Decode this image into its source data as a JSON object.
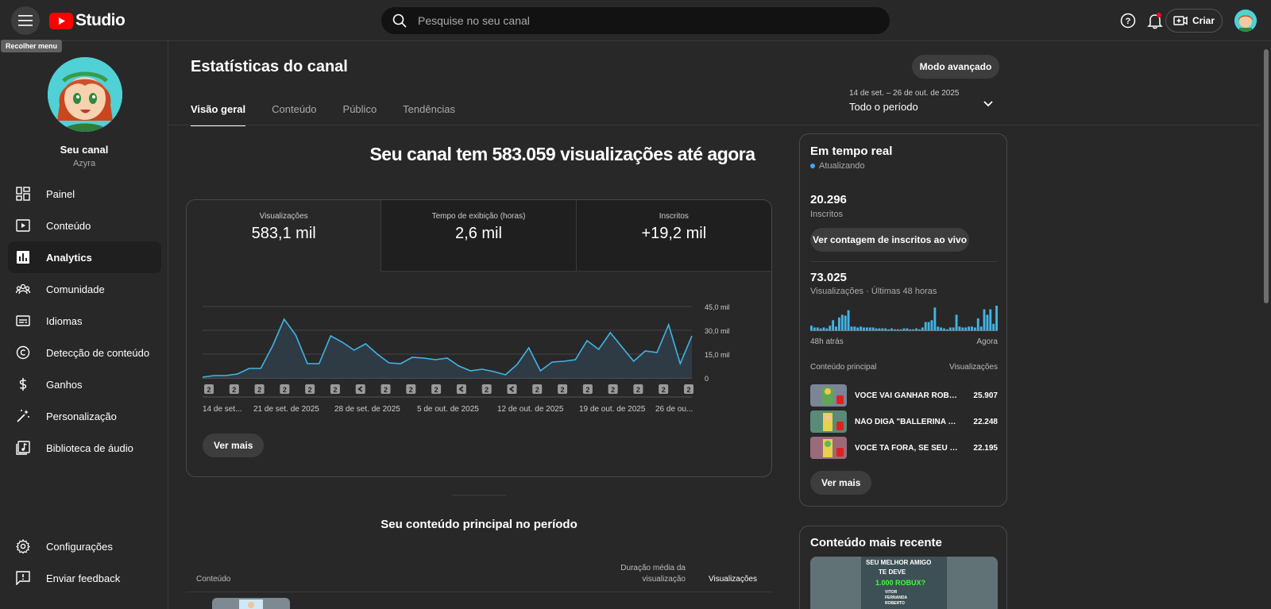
{
  "header": {
    "logo_text": "Studio",
    "collapse_tooltip": "Recolher menu",
    "search_placeholder": "Pesquise no seu canal",
    "create_label": "Criar"
  },
  "sidebar": {
    "channel_name": "Seu canal",
    "channel_handle": "Azyra",
    "items": [
      {
        "label": "Painel",
        "icon": "dashboard-icon"
      },
      {
        "label": "Conteúdo",
        "icon": "content-icon"
      },
      {
        "label": "Analytics",
        "icon": "analytics-icon",
        "active": true
      },
      {
        "label": "Comunidade",
        "icon": "community-icon"
      },
      {
        "label": "Idiomas",
        "icon": "subtitles-icon"
      },
      {
        "label": "Detecção de conteúdo",
        "icon": "copyright-icon"
      },
      {
        "label": "Ganhos",
        "icon": "dollar-icon"
      },
      {
        "label": "Personalização",
        "icon": "magic-wand-icon"
      },
      {
        "label": "Biblioteca de áudio",
        "icon": "audio-library-icon"
      }
    ],
    "bottom_items": [
      {
        "label": "Configurações",
        "icon": "gear-icon"
      },
      {
        "label": "Enviar feedback",
        "icon": "feedback-icon"
      }
    ]
  },
  "main": {
    "title": "Estatísticas do canal",
    "advanced_label": "Modo avançado",
    "tabs": [
      {
        "label": "Visão geral",
        "active": true
      },
      {
        "label": "Conteúdo"
      },
      {
        "label": "Público"
      },
      {
        "label": "Tendências"
      }
    ],
    "period_range": "14 de set. – 26 de out. de 2025",
    "period_label": "Todo o período",
    "headline": "Seu canal tem 583.059 visualizações até agora",
    "metrics": [
      {
        "label": "Visualizações",
        "value": "583,1 mil"
      },
      {
        "label": "Tempo de exibição (horas)",
        "value": "2,6 mil"
      },
      {
        "label": "Inscritos",
        "value": "+19,2 mil"
      }
    ],
    "chart_more_label": "Ver mais",
    "top_content_title": "Seu conteúdo principal no período",
    "top_content_headers": {
      "content": "Conteúdo",
      "avg_duration": "Duração média da visualização",
      "views": "Visualizações"
    }
  },
  "chart_data": {
    "type": "area",
    "x_labels": [
      "14 de set...",
      "21 de set. de 2025",
      "28 de set. de 2025",
      "5 de out. de 2025",
      "12 de out. de 2025",
      "19 de out. de 2025",
      "26 de ou..."
    ],
    "y_ticks": [
      "45,0 mil",
      "30,0 mil",
      "15,0 mil",
      "0"
    ],
    "ylim": [
      0,
      45000
    ],
    "values": [
      500,
      1500,
      1500,
      2500,
      6000,
      6000,
      20000,
      37000,
      27000,
      9000,
      9000,
      26500,
      22500,
      17500,
      21500,
      15000,
      9500,
      9000,
      13000,
      12500,
      11500,
      12500,
      7500,
      4500,
      5500,
      4000,
      2000,
      8500,
      19000,
      4500,
      10000,
      10500,
      11500,
      23500,
      18000,
      28500,
      19500,
      10500,
      17000,
      16000,
      33500,
      9000,
      26500
    ],
    "upload_markers": [
      "2",
      "2",
      "2",
      "2",
      "2",
      "2",
      "short",
      "2",
      "2",
      "2",
      "short",
      "2",
      "short",
      "2",
      "2",
      "2",
      "2",
      "2",
      "2",
      "2"
    ],
    "color": "#41b4e6"
  },
  "realtime": {
    "title": "Em tempo real",
    "status": "Atualizando",
    "subscribers": "20.296",
    "subscribers_label": "Inscritos",
    "live_count_label": "Ver contagem de inscritos ao vivo",
    "views": "73.025",
    "views_label": "Visualizações · Últimas 48 horas",
    "hourly_views": [
      6,
      4,
      4,
      3,
      4,
      3,
      6,
      12,
      5,
      15,
      18,
      17,
      23,
      5,
      5,
      4,
      5,
      4,
      4,
      4,
      4,
      3,
      3,
      3,
      3,
      2,
      3,
      2,
      2,
      2,
      3,
      3,
      2,
      2,
      3,
      2,
      4,
      10,
      10,
      12,
      26,
      5,
      4,
      3,
      2,
      4,
      4,
      18,
      5,
      4,
      4,
      5,
      5,
      4,
      14,
      5,
      24,
      18,
      24,
      8,
      28
    ],
    "ago_label": "48h atrás",
    "now_label": "Agora",
    "col_content": "Conteúdo principal",
    "col_views": "Visualizações",
    "top": [
      {
        "title": "VOCÊ VAI GANHAR ROBUX",
        "views": "25.907"
      },
      {
        "title": "NÃO DIGA \"BALLERINA CAPPUCCINA\"",
        "views": "22.248"
      },
      {
        "title": "VOCÊ TA FORA, SE SEU NOME",
        "views": "22.195"
      }
    ],
    "more_label": "Ver mais"
  },
  "recent": {
    "title": "Conteúdo mais recente",
    "thumb_line1": "SEU MELHOR AMIGO",
    "thumb_line2": "TE DEVE",
    "thumb_line3": "1.000 ROBUX?",
    "thumb_names": [
      "VITOR",
      "FERNANDA",
      "ROBERTO"
    ]
  }
}
